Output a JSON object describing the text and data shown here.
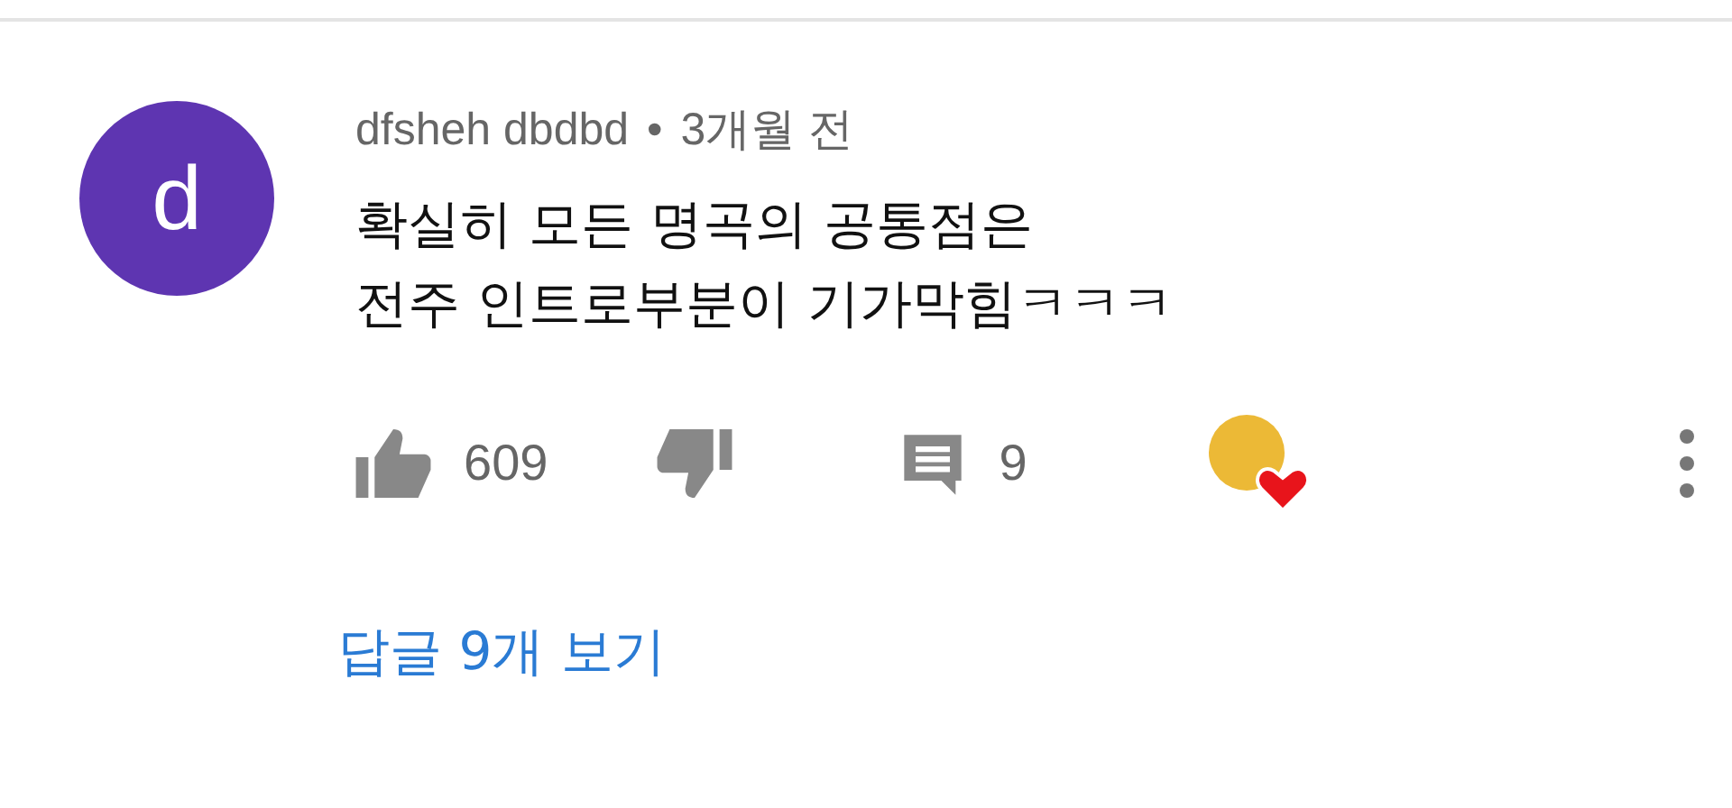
{
  "comment": {
    "avatar_letter": "d",
    "author": "dfsheh dbdbd",
    "separator": "•",
    "time": "3개월 전",
    "body_lines": [
      "확실히 모든 명곡의 공통점은",
      "전주 인트로부분이 기가막힘ㅋㅋㅋ"
    ],
    "likes": "609",
    "reply_count": "9",
    "hearted": true
  },
  "view_replies": "답글 9개 보기"
}
